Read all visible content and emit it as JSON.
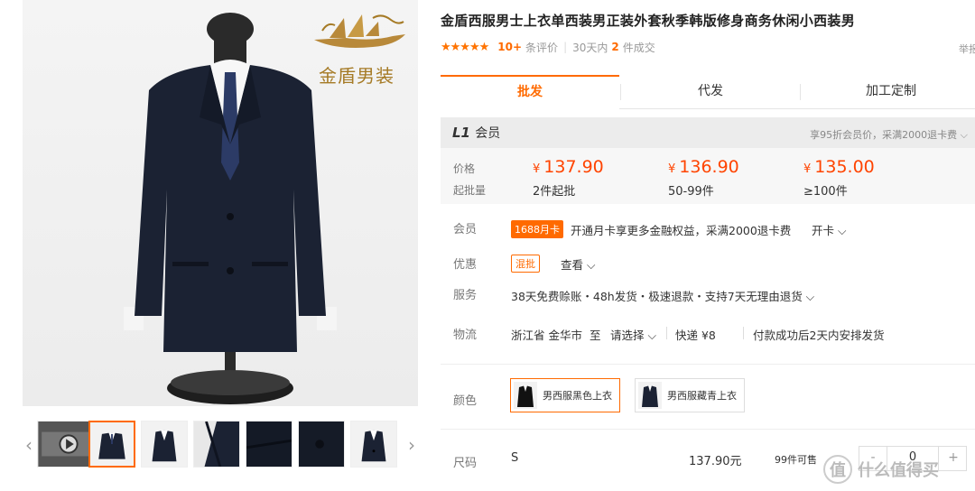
{
  "gallery": {
    "brand_name": "金盾男装",
    "thumb_count": 7,
    "active_thumb": 1
  },
  "product": {
    "title": "金盾西服男士上衣单西装男正装外套秋季韩版修身商务休闲小西装男",
    "stars": "★★★★★",
    "review_count": "10+",
    "review_label": "条评价",
    "sales_period": "30天内",
    "sales_count": "2",
    "sales_label": "件成交",
    "report_label": "举报"
  },
  "tabs": [
    {
      "label": "批发",
      "active": true
    },
    {
      "label": "代发",
      "active": false
    },
    {
      "label": "加工定制",
      "active": false
    }
  ],
  "member": {
    "level_prefix": "L1",
    "level_label": "会员",
    "note": "享95折会员价，采满2000退卡费 ⌵"
  },
  "pricing": {
    "price_label": "价格",
    "moq_label": "起批量",
    "currency": "¥",
    "tiers": [
      {
        "price": "137.90",
        "qty": "2件起批"
      },
      {
        "price": "136.90",
        "qty": "50-99件"
      },
      {
        "price": "135.00",
        "qty": "≥100件"
      }
    ]
  },
  "rows": {
    "member_label": "会员",
    "member_badge": "1688月卡",
    "member_text": "开通月卡享更多金融权益，采满2000退卡费",
    "member_link": "开卡 ⌵",
    "promo_label": "优惠",
    "promo_badge": "混批",
    "promo_link": "查看 ⌵",
    "service_label": "服务",
    "service_text": "38天免费赊账・48h发货・极速退款・支持7天无理由退货 ⌵",
    "logistics_label": "物流",
    "origin": "浙江省 金华市",
    "to": "至",
    "destination": "请选择 ⌵",
    "shipping": "快递  ¥8",
    "ship_note": "付款成功后2天内安排发货"
  },
  "colors": {
    "label": "颜色",
    "options": [
      {
        "label": "男西服黑色上衣",
        "selected": true
      },
      {
        "label": "男西服藏青上衣",
        "selected": false
      }
    ]
  },
  "size": {
    "label": "尺码",
    "value": "S",
    "price": "137.90元",
    "stock": "99件可售",
    "quantity": "0",
    "minus": "-",
    "plus": "+"
  },
  "watermark": {
    "icon_text": "值",
    "text": "什么值得买"
  },
  "colors_palette": {
    "accent": "#ff6a00",
    "price": "#ff4400",
    "suit": "#1b2233"
  }
}
